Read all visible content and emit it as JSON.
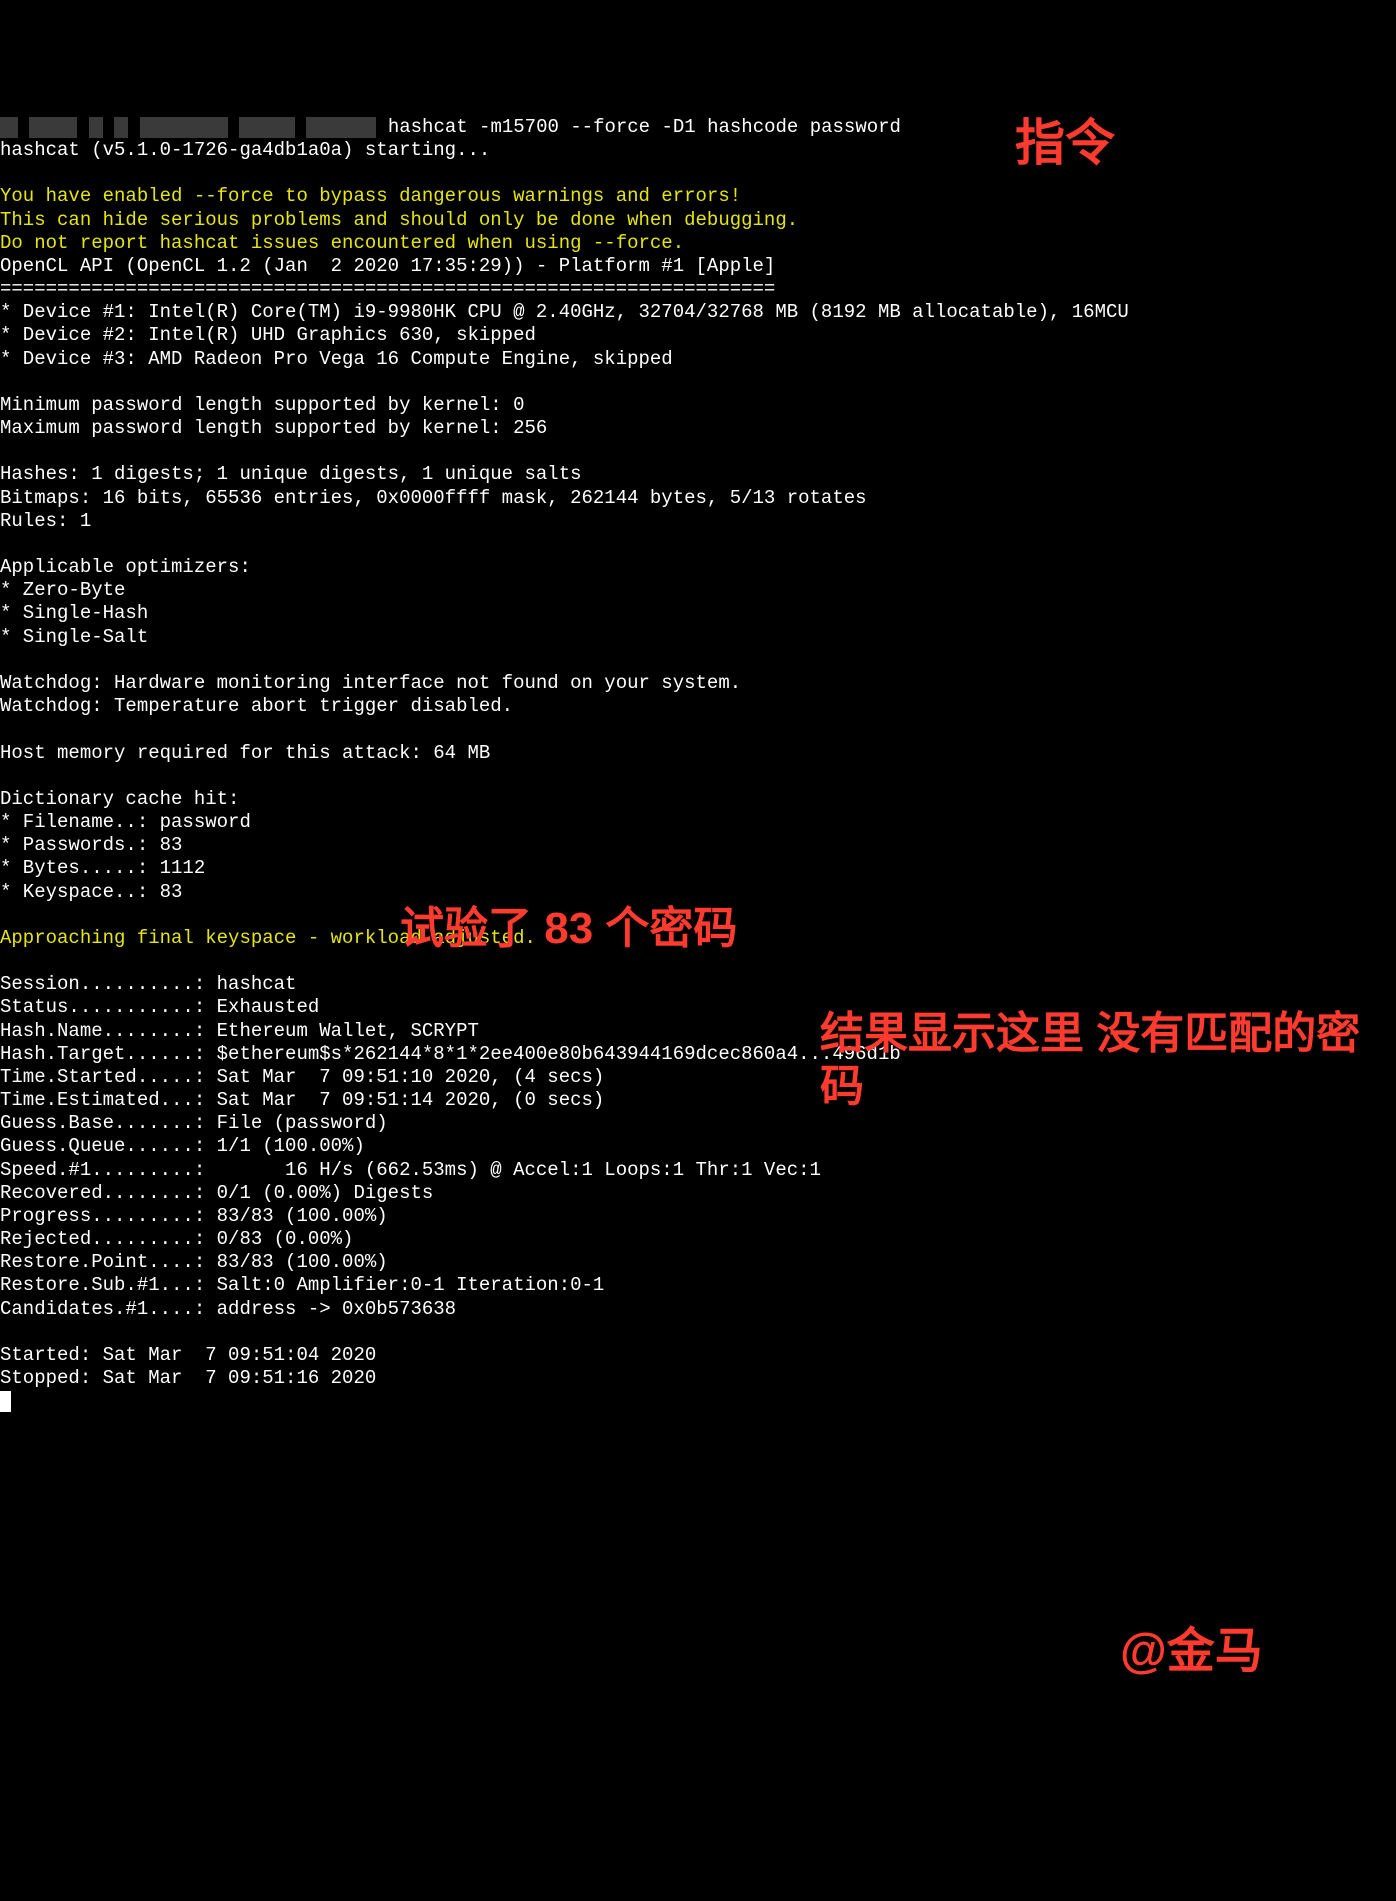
{
  "prompt": {
    "redact_widths": [
      18,
      48,
      14,
      14,
      88,
      56,
      70
    ],
    "cmd": " hashcat -m15700 --force -D1 hashcode password"
  },
  "starting": "hashcat (v5.1.0-1726-ga4db1a0a) starting...",
  "warn1": "You have enabled --force to bypass dangerous warnings and errors!",
  "warn2": "This can hide serious problems and should only be done when debugging.",
  "warn3": "Do not report hashcat issues encountered when using --force.",
  "opencl": "OpenCL API (OpenCL 1.2 (Jan  2 2020 17:35:29)) - Platform #1 [Apple]",
  "hr": "====================================================================",
  "dev1": "* Device #1: Intel(R) Core(TM) i9-9980HK CPU @ 2.40GHz, 32704/32768 MB (8192 MB allocatable), 16MCU",
  "dev2": "* Device #2: Intel(R) UHD Graphics 630, skipped",
  "dev3": "* Device #3: AMD Radeon Pro Vega 16 Compute Engine, skipped",
  "minlen": "Minimum password length supported by kernel: 0",
  "maxlen": "Maximum password length supported by kernel: 256",
  "hashes": "Hashes: 1 digests; 1 unique digests, 1 unique salts",
  "bitmaps": "Bitmaps: 16 bits, 65536 entries, 0x0000ffff mask, 262144 bytes, 5/13 rotates",
  "rules": "Rules: 1",
  "opts_hdr": "Applicable optimizers:",
  "opt1": "* Zero-Byte",
  "opt2": "* Single-Hash",
  "opt3": "* Single-Salt",
  "wd1": "Watchdog: Hardware monitoring interface not found on your system.",
  "wd2": "Watchdog: Temperature abort trigger disabled.",
  "hostmem": "Host memory required for this attack: 64 MB",
  "cachehdr": "Dictionary cache hit:",
  "cache_fn": "* Filename..: password",
  "cache_pw": "* Passwords.: 83",
  "cache_by": "* Bytes.....: 1112",
  "cache_ks": "* Keyspace..: 83",
  "approach": "Approaching final keyspace - workload adjusted.",
  "s_session": "Session..........: hashcat",
  "s_status": "Status...........: Exhausted",
  "s_hashname": "Hash.Name........: Ethereum Wallet, SCRYPT",
  "s_target": "Hash.Target......: $ethereum$s*262144*8*1*2ee400e80b643944169dcec860a4...496d1b",
  "s_started": "Time.Started.....: Sat Mar  7 09:51:10 2020, (4 secs)",
  "s_est": "Time.Estimated...: Sat Mar  7 09:51:14 2020, (0 secs)",
  "s_gbase": "Guess.Base.......: File (password)",
  "s_gqueue": "Guess.Queue......: 1/1 (100.00%)",
  "s_speed": "Speed.#1.........:       16 H/s (662.53ms) @ Accel:1 Loops:1 Thr:1 Vec:1",
  "s_recov": "Recovered........: 0/1 (0.00%) Digests",
  "s_prog": "Progress.........: 83/83 (100.00%)",
  "s_rej": "Rejected.........: 0/83 (0.00%)",
  "s_rpoint": "Restore.Point....: 83/83 (100.00%)",
  "s_rsub": "Restore.Sub.#1...: Salt:0 Amplifier:0-1 Iteration:0-1",
  "s_cand": "Candidates.#1....: address -> 0x0b573638",
  "started": "Started: Sat Mar  7 09:51:04 2020",
  "stopped": "Stopped: Sat Mar  7 09:51:16 2020",
  "annot": {
    "cmd": "指令",
    "tries": "试验了 83 个密码",
    "result": "结果显示这里\n没有匹配的密码",
    "sig": "@金马"
  }
}
